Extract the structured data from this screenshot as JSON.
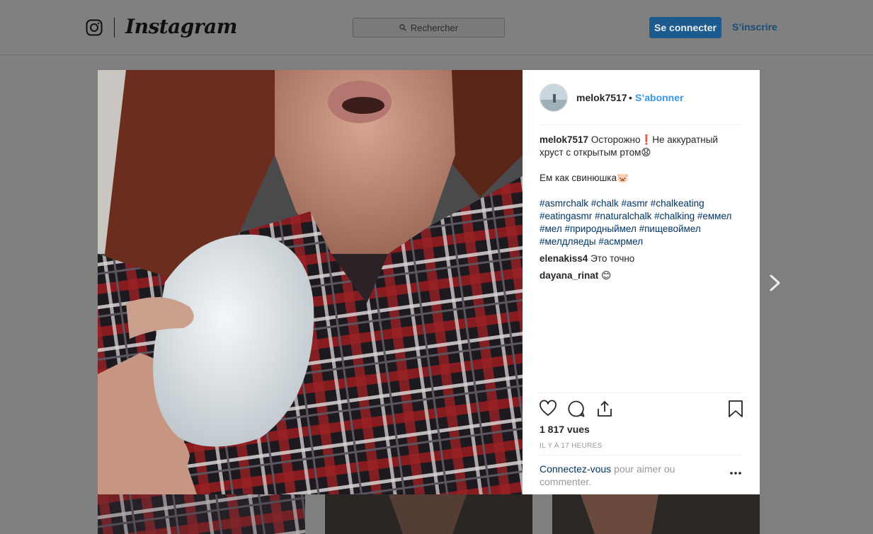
{
  "header": {
    "wordmark": "Instagram",
    "search_placeholder": "Rechercher",
    "login_label": "Se connecter",
    "signup_label": "S’inscrire",
    "icons": [
      "instagram-camera-icon",
      "search-icon"
    ]
  },
  "post": {
    "owner": "melok7517",
    "separator": "•",
    "follow_label": "S’abonner",
    "caption": {
      "username": "melok7517",
      "line1": "Осторожно❗Не аккуратный хруст с открытым ртом😧",
      "line2": "Ем как свинюшка🐷",
      "hashtags": "#asmrchalk #chalk #asmr #chalkeating #eatingasmr #naturalchalk #chalking #еммел #мел #природныймел #пищевоймел #мелдляеды #асмрмел"
    },
    "comments": [
      {
        "username": "elenakiss4",
        "text": "Это точно"
      },
      {
        "username": "dayana_rinat",
        "text": "😊"
      }
    ],
    "views": "1 817 vues",
    "time": "IL Y A 17 HEURES",
    "login_link": "Connectez-vous",
    "login_rest": " pour aimer ou commenter.",
    "icons": [
      "heart-icon",
      "comment-icon",
      "share-icon",
      "bookmark-icon",
      "more-options-icon",
      "next-arrow-icon"
    ]
  },
  "colors": {
    "accent_blue": "#3897f0",
    "login_button": "#1d5a8d",
    "hashtag": "#003569"
  }
}
